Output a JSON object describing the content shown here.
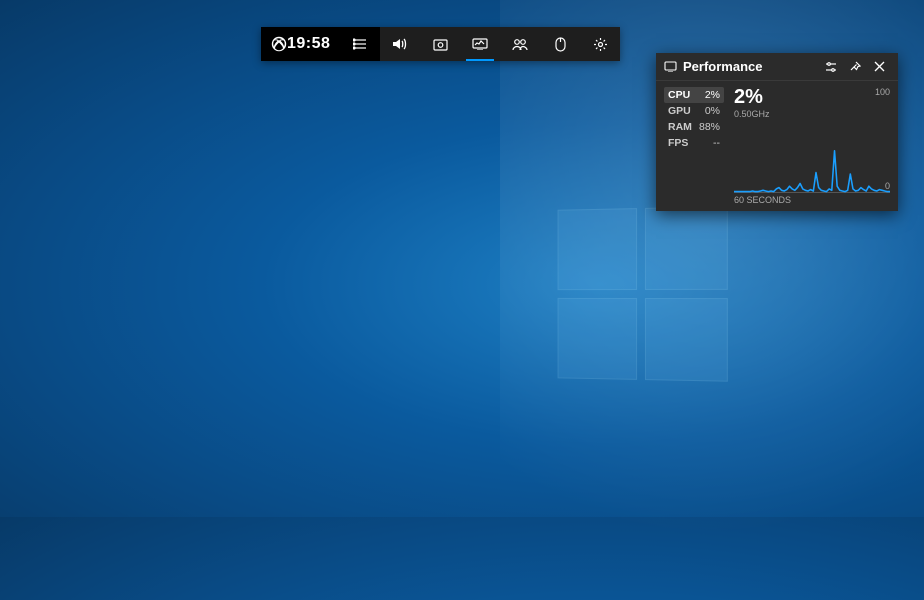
{
  "gamebar": {
    "time": "19:58",
    "icons": {
      "xbox": "xbox-icon",
      "menu": "menu-icon",
      "audio": "audio-icon",
      "capture": "capture-icon",
      "performance": "performance-icon",
      "social": "social-icon",
      "mouse": "mouse-icon",
      "settings": "settings-icon"
    }
  },
  "performance_panel": {
    "title": "Performance",
    "stats": [
      {
        "label": "CPU",
        "value": "2%",
        "active": true
      },
      {
        "label": "GPU",
        "value": "0%",
        "active": false
      },
      {
        "label": "RAM",
        "value": "88%",
        "active": false
      },
      {
        "label": "FPS",
        "value": "--",
        "active": false
      }
    ],
    "big_value": "2%",
    "freq": "0.50GHz",
    "y_max": "100",
    "y_min": "0",
    "x_label": "60 SECONDS"
  },
  "chart_data": {
    "type": "line",
    "x": [
      0,
      1,
      2,
      3,
      4,
      5,
      6,
      7,
      8,
      9,
      10,
      11,
      12,
      13,
      14,
      15,
      16,
      17,
      18,
      19,
      20,
      21,
      22,
      23,
      24,
      25,
      26,
      27,
      28,
      29,
      30,
      31,
      32,
      33,
      34,
      35,
      36,
      37,
      38,
      39,
      40,
      41,
      42,
      43,
      44,
      45,
      46,
      47,
      48,
      49,
      50,
      51,
      52,
      53,
      54,
      55,
      56,
      57,
      58,
      59
    ],
    "values": [
      2,
      2,
      2,
      2,
      2,
      2,
      2,
      3,
      2,
      2,
      3,
      4,
      3,
      2,
      3,
      2,
      6,
      8,
      4,
      3,
      5,
      10,
      6,
      4,
      8,
      14,
      6,
      4,
      3,
      5,
      3,
      30,
      8,
      4,
      3,
      2,
      6,
      4,
      62,
      10,
      4,
      3,
      2,
      4,
      28,
      6,
      3,
      4,
      8,
      5,
      3,
      10,
      6,
      4,
      3,
      5,
      4,
      3,
      2,
      2
    ],
    "title": "CPU usage",
    "xlabel": "60 SECONDS",
    "ylabel": "",
    "ylim": [
      0,
      100
    ],
    "color": "#1a9fff"
  }
}
